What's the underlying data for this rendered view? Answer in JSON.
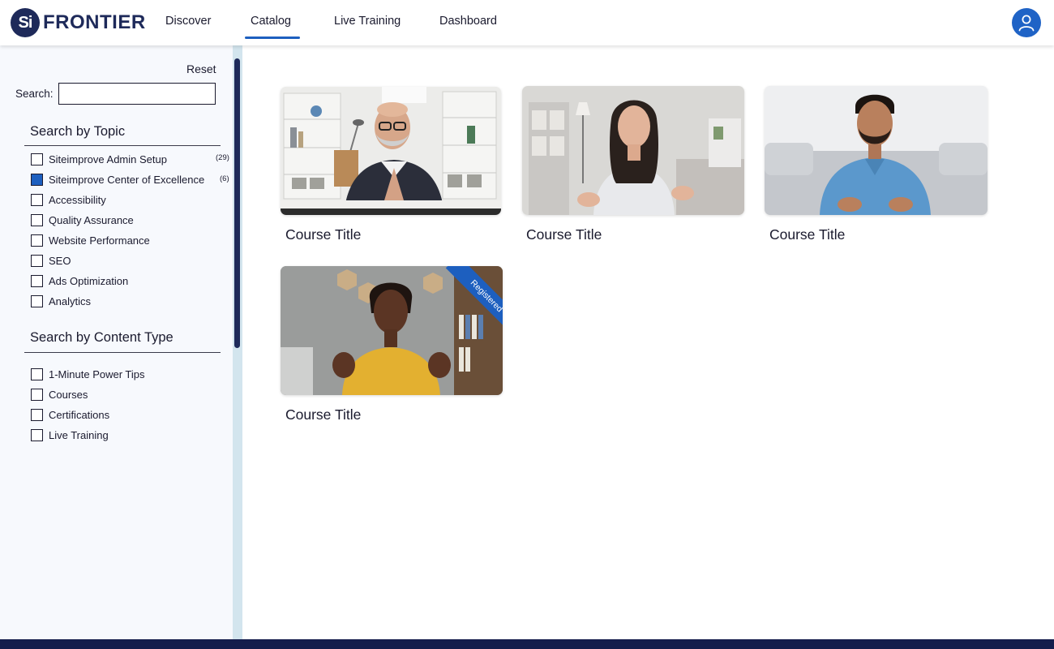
{
  "brand": {
    "badge": "Si",
    "name": "FRONTIER"
  },
  "nav": {
    "items": [
      {
        "label": "Discover"
      },
      {
        "label": "Catalog",
        "active": true
      },
      {
        "label": "Live Training"
      },
      {
        "label": "Dashboard"
      }
    ]
  },
  "header": {
    "avatar_icon": "user-icon"
  },
  "sidebar": {
    "reset_label": "Reset",
    "search_label": "Search:",
    "search_value": "",
    "topic_title": "Search by Topic",
    "topics": [
      {
        "label": "Siteimprove Admin Setup",
        "checked": false,
        "count": "(29)"
      },
      {
        "label": "Siteimprove Center of Excellence",
        "checked": true,
        "count": "(6)"
      },
      {
        "label": "Accessibility",
        "checked": false
      },
      {
        "label": "Quality Assurance",
        "checked": false
      },
      {
        "label": "Website Performance",
        "checked": false
      },
      {
        "label": "SEO",
        "checked": false
      },
      {
        "label": "Ads Optimization",
        "checked": false
      },
      {
        "label": "Analytics",
        "checked": false
      }
    ],
    "content_type_title": "Search by Content Type",
    "content_types": [
      {
        "label": "1-Minute Power Tips",
        "checked": false
      },
      {
        "label": "Courses",
        "checked": false
      },
      {
        "label": "Certifications",
        "checked": false
      },
      {
        "label": "Live Training",
        "checked": false
      }
    ]
  },
  "courses": [
    {
      "title": "Course Title",
      "thumbnail": "bald-man-glasses-office"
    },
    {
      "title": "Course Title",
      "thumbnail": "woman-living-room"
    },
    {
      "title": "Course Title",
      "thumbnail": "man-blue-shirt-sofa"
    },
    {
      "title": "Course Title",
      "thumbnail": "woman-yellow-shirt-office",
      "ribbon": "Registered"
    }
  ],
  "colors": {
    "navy": "#1e2a5a",
    "accent_blue": "#1d5fbf",
    "sidebar_bg": "#f7f9fd",
    "footer": "#141d4c"
  }
}
